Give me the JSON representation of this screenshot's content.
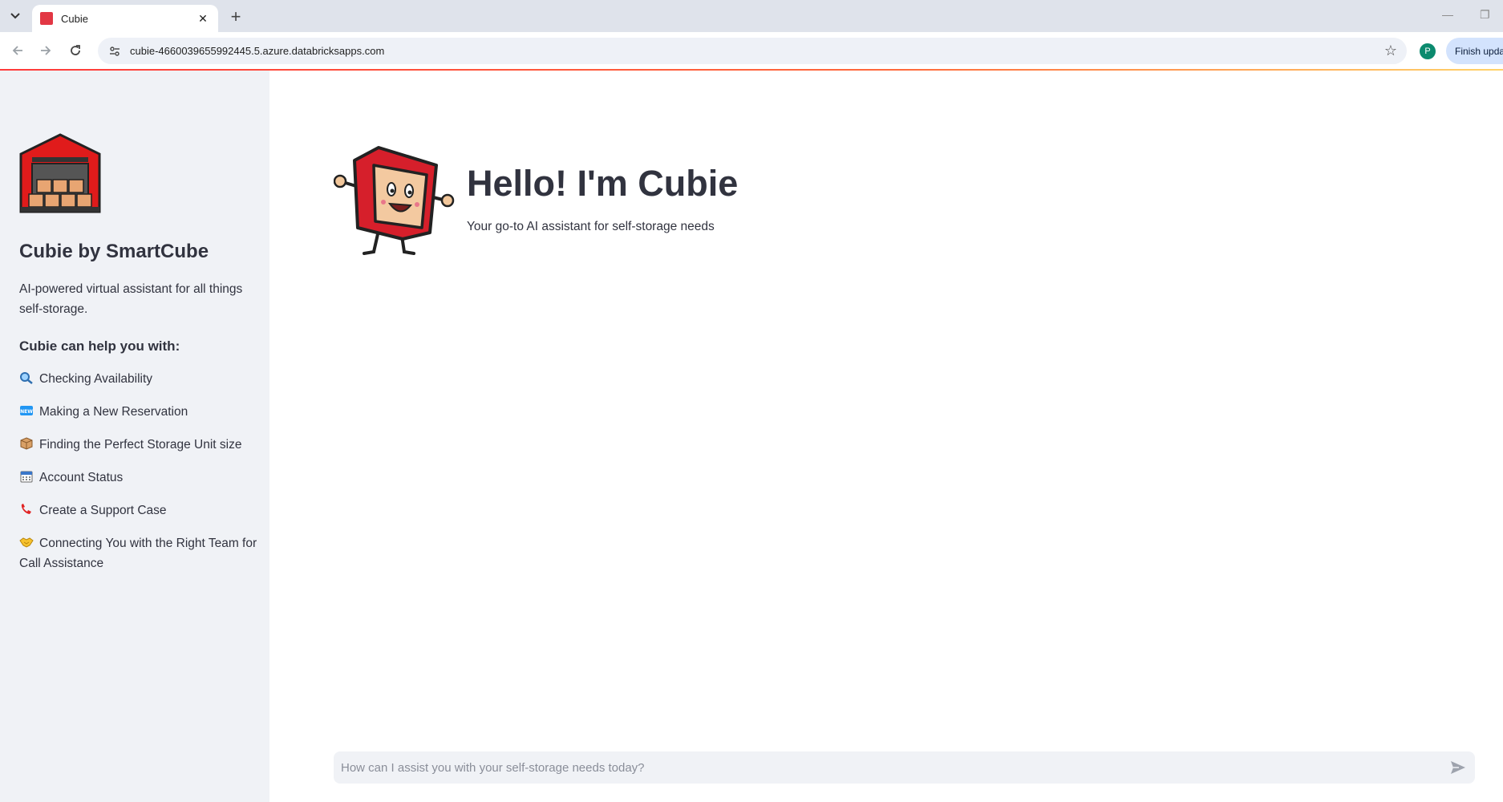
{
  "browser": {
    "tab_title": "Cubie",
    "tab_close": "✕",
    "new_tab": "+",
    "url": "cubie-4660039655992445.5.azure.databricksapps.com",
    "profile_initial": "P",
    "finish_update_label": "Finish update",
    "favicon_color": "#e23744"
  },
  "sidebar": {
    "title": "Cubie by SmartCube",
    "description": "AI-powered virtual assistant for all things self-storage.",
    "help_heading": "Cubie can help you with:",
    "items": [
      {
        "icon": "magnifier-icon",
        "label": "Checking Availability"
      },
      {
        "icon": "new-badge-icon",
        "label": "Making a New Reservation"
      },
      {
        "icon": "package-icon",
        "label": "Finding the Perfect Storage Unit size"
      },
      {
        "icon": "calendar-icon",
        "label": "Account Status"
      },
      {
        "icon": "phone-icon",
        "label": "Create a Support Case"
      },
      {
        "icon": "handshake-icon",
        "label": "Connecting You with the Right Team for Call Assistance"
      }
    ]
  },
  "main": {
    "heading": "Hello! I'm Cubie",
    "subheading": "Your go-to AI assistant for self-storage needs",
    "chat_placeholder": "How can I assist you with your self-storage needs today?"
  },
  "colors": {
    "accent_red": "#e23744",
    "sidebar_bg": "#f0f2f6",
    "text": "#31333f"
  }
}
